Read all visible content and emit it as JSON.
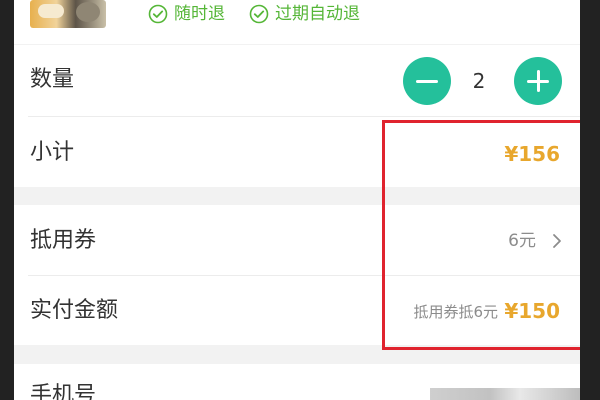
{
  "product": {
    "thumbnail_icon": "cake-thumbnail",
    "badges": [
      {
        "label": "随时退",
        "icon": "check-circle-icon"
      },
      {
        "label": "过期自动退",
        "icon": "check-circle-icon"
      }
    ]
  },
  "quantity": {
    "label": "数量",
    "value": "2",
    "decrement_icon": "minus-icon",
    "increment_icon": "plus-icon"
  },
  "subtotal": {
    "label": "小计",
    "value": "¥156"
  },
  "coupon": {
    "label": "抵用券",
    "value": "6元",
    "icon": "chevron-right-icon"
  },
  "paid": {
    "label": "实付金额",
    "note": "抵用券抵6元",
    "value": "¥150"
  },
  "phone": {
    "label": "手机号"
  },
  "colors": {
    "accent": "#24c09b",
    "price": "#e8a72d",
    "badge_green": "#55b637",
    "highlight": "#e0232e"
  }
}
